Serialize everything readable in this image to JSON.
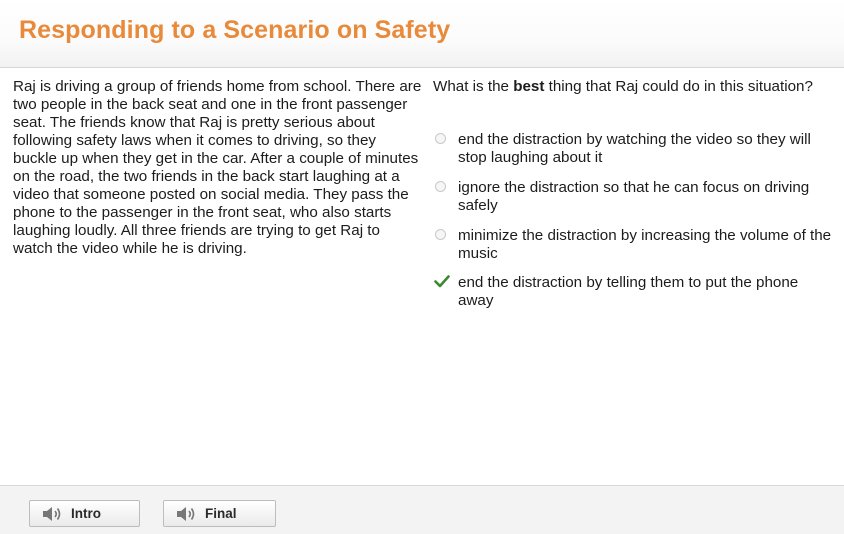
{
  "header": {
    "title": "Responding to a Scenario on Safety"
  },
  "passage": {
    "text": "Raj is driving a group of friends home from school. There are two people in the back seat and one in the front passenger seat. The friends know that Raj is pretty serious about following safety laws when it comes to driving, so they buckle up when they get in the car. After a couple of minutes on the road, the two friends in the back start laughing at a video that someone posted on social media. They pass the phone to the passenger in the front seat, who also starts laughing loudly. All three friends are trying to get Raj to watch the video while he is driving."
  },
  "question": {
    "prefix": "What is the ",
    "emphasis": "best",
    "suffix": " thing that Raj could do in this situation?"
  },
  "options": [
    {
      "label": "end the distraction by watching the video so they will stop laughing about it",
      "selected": false
    },
    {
      "label": "ignore the distraction so that he can focus on driving safely",
      "selected": false
    },
    {
      "label": "minimize the distraction by increasing the volume of the music",
      "selected": false
    },
    {
      "label": "end the distraction by telling them to put the phone away",
      "selected": true
    }
  ],
  "footer": {
    "intro_label": "Intro",
    "final_label": "Final"
  },
  "colors": {
    "title": "#e88a3a",
    "check": "#3a8a2e"
  },
  "icons": {
    "audio": "speaker-icon",
    "correct": "checkmark-icon"
  }
}
